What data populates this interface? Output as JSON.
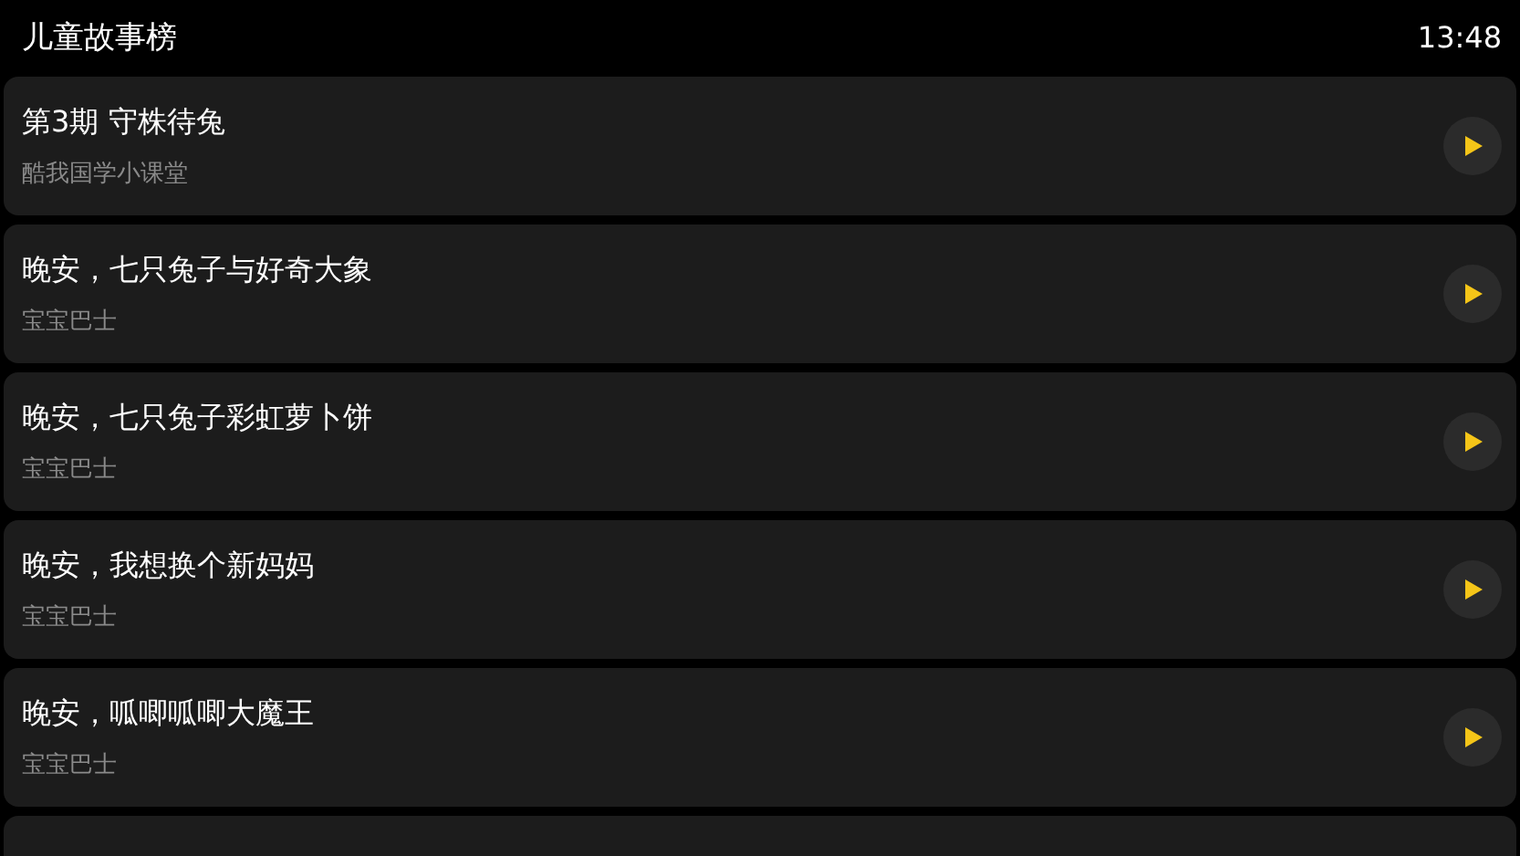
{
  "header": {
    "title": "儿童故事榜",
    "time": "13:48"
  },
  "stories": [
    {
      "title": "第3期 守株待兔",
      "author": "酷我国学小课堂"
    },
    {
      "title": "晚安，七只兔子与好奇大象",
      "author": "宝宝巴士"
    },
    {
      "title": "晚安，七只兔子彩虹萝卜饼",
      "author": "宝宝巴士"
    },
    {
      "title": "晚安，我想换个新妈妈",
      "author": "宝宝巴士"
    },
    {
      "title": "晚安，呱唧呱唧大魔王",
      "author": "宝宝巴士"
    }
  ]
}
